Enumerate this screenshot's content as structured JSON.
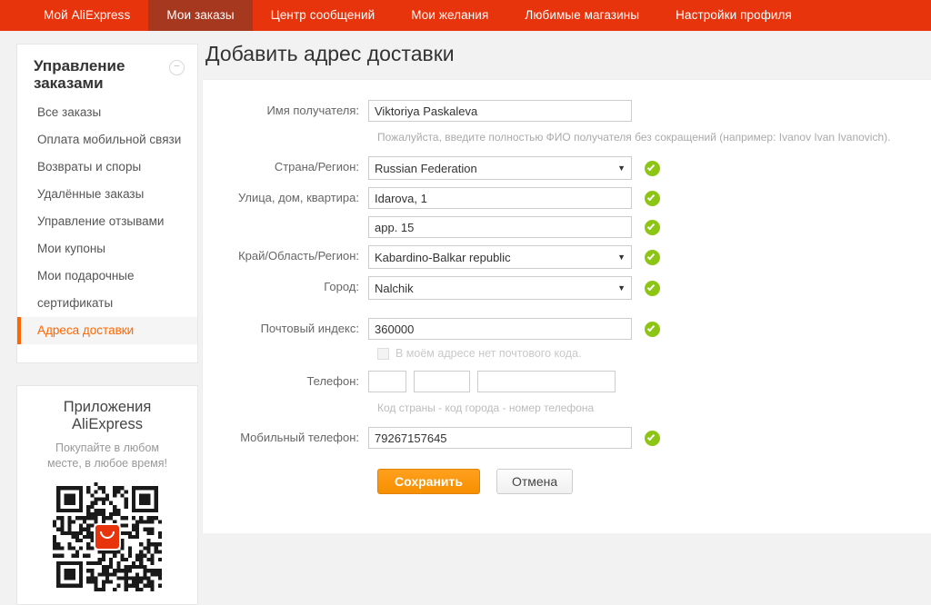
{
  "topnav": {
    "items": [
      {
        "label": "Мой AliExpress",
        "active": false
      },
      {
        "label": "Мои заказы",
        "active": true
      },
      {
        "label": "Центр сообщений",
        "active": false
      },
      {
        "label": "Мои желания",
        "active": false
      },
      {
        "label": "Любимые магазины",
        "active": false
      },
      {
        "label": "Настройки профиля",
        "active": false
      }
    ],
    "bg_color": "#e8340c",
    "active_bg_color": "#a5381f"
  },
  "sidebar": {
    "title": "Управление заказами",
    "collapse_icon": "minus-circle-icon",
    "items": [
      {
        "label": "Все заказы",
        "active": false
      },
      {
        "label": "Оплата мобильной связи",
        "active": false
      },
      {
        "label": "Возвраты и споры",
        "active": false
      },
      {
        "label": "Удалённые заказы",
        "active": false
      },
      {
        "label": "Управление отзывами",
        "active": false
      },
      {
        "label": "Мои купоны",
        "active": false
      },
      {
        "label": "Мои подарочные",
        "active": false
      },
      {
        "label": "сертификаты",
        "active": false
      },
      {
        "label": "Адреса доставки",
        "active": true
      }
    ],
    "active_color": "#ff6600"
  },
  "app_promo": {
    "title": "Приложения AliExpress",
    "subtitle": "Покупайте в любом месте, в любое время!",
    "qr_icon": "qr-code-icon",
    "logo_icon": "aliexpress-app-logo-icon"
  },
  "main": {
    "page_title": "Добавить адрес доставки",
    "fields": {
      "recipient": {
        "label": "Имя получателя:",
        "value": "Viktoriya Paskaleva",
        "placeholder": "",
        "hint": "Пожалуйста, введите полностью ФИО получателя без сокращений (например: Ivanov Ivan Ivanovich)."
      },
      "country": {
        "label": "Страна/Регион:",
        "value": "Russian Federation",
        "options": [
          "Russian Federation"
        ],
        "valid": true
      },
      "street": {
        "label": "Улица, дом, квартира:",
        "value": "Idarova, 1",
        "valid": true
      },
      "street2": {
        "label": "",
        "value": "app. 15",
        "valid": true
      },
      "province": {
        "label": "Край/Область/Регион:",
        "value": "Kabardino-Balkar republic",
        "options": [
          "Kabardino-Balkar republic"
        ],
        "valid": true
      },
      "city": {
        "label": "Город:",
        "value": "Nalchik",
        "options": [
          "Nalchik"
        ],
        "valid": true
      },
      "zip": {
        "label": "Почтовый индекс:",
        "value": "360000",
        "valid": true,
        "no_zip_label": "В моём адресе нет почтового кода.",
        "no_zip_checked": false
      },
      "phone": {
        "label": "Телефон:",
        "country_code": "",
        "area_code": "",
        "number": "",
        "hint": "Код страны - код города - номер телефона"
      },
      "mobile": {
        "label": "Мобильный телефон:",
        "value": "79267157645",
        "valid": true
      }
    },
    "buttons": {
      "save": "Сохранить",
      "cancel": "Отмена"
    },
    "valid_icon": "check-circle-icon",
    "dropdown_icon": "chevron-down-icon",
    "accent_color": "#ff9900",
    "valid_color": "#8dc514"
  }
}
